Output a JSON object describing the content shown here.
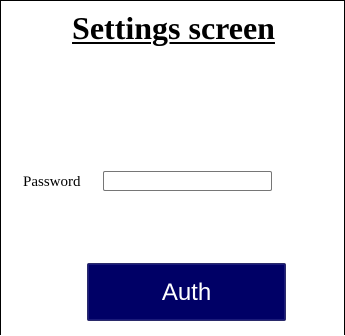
{
  "screen": {
    "title": "Settings screen"
  },
  "form": {
    "password_label": "Password",
    "password_value": "",
    "password_placeholder": ""
  },
  "actions": {
    "auth_label": "Auth"
  },
  "colors": {
    "button_background": "#000066",
    "button_text": "#ffffff",
    "page_background": "#ffffff",
    "border": "#000000"
  }
}
